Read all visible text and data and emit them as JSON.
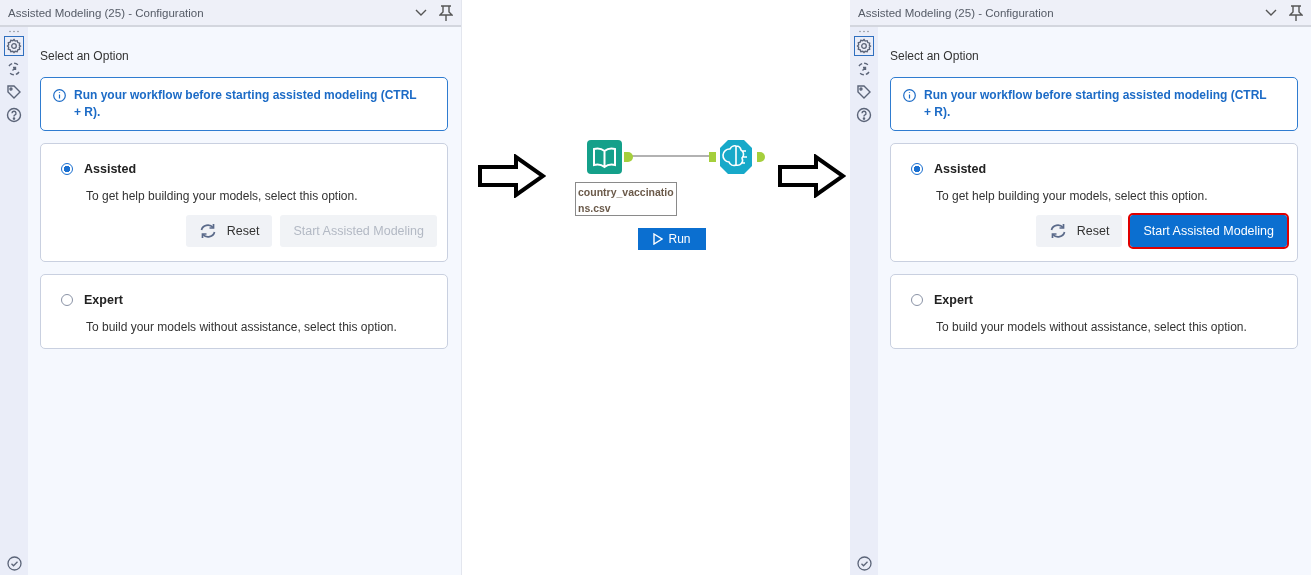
{
  "panels": [
    {
      "title": "Assisted Modeling (25) - Configuration",
      "tabs": [
        {
          "kind": "gear",
          "selected": true
        },
        {
          "kind": "connect",
          "selected": false
        },
        {
          "kind": "tag",
          "selected": false
        },
        {
          "kind": "help",
          "selected": false
        }
      ],
      "heading": "Select an Option",
      "info": "Run your workflow before starting assisted modeling (CTRL + R).",
      "options": [
        {
          "label": "Assisted",
          "description": "To get help building your models, select this option.",
          "selected": true,
          "buttons": [
            {
              "kind": "reset",
              "label": "Reset",
              "disabled": false,
              "highlighted": false
            },
            {
              "kind": "primary",
              "label": "Start Assisted Modeling",
              "disabled": true,
              "highlighted": false
            }
          ]
        },
        {
          "label": "Expert",
          "description": "To build your models without assistance, select this option.",
          "selected": false
        }
      ]
    },
    {
      "title": "Assisted Modeling (25) - Configuration",
      "tabs": [
        {
          "kind": "gear",
          "selected": true
        },
        {
          "kind": "connect",
          "selected": false
        },
        {
          "kind": "tag",
          "selected": false
        },
        {
          "kind": "help",
          "selected": false
        }
      ],
      "heading": "Select an Option",
      "info": "Run your workflow before starting assisted modeling (CTRL + R).",
      "options": [
        {
          "label": "Assisted",
          "description": "To get help building your models, select this option.",
          "selected": true,
          "buttons": [
            {
              "kind": "reset",
              "label": "Reset",
              "disabled": false,
              "highlighted": false
            },
            {
              "kind": "primary",
              "label": "Start Assisted Modeling",
              "disabled": false,
              "highlighted": true
            }
          ]
        },
        {
          "label": "Expert",
          "description": "To build your models without assistance, select this option.",
          "selected": false
        }
      ]
    }
  ],
  "canvas": {
    "input_label": "country_vaccinations.csv",
    "run_button": "Run"
  }
}
